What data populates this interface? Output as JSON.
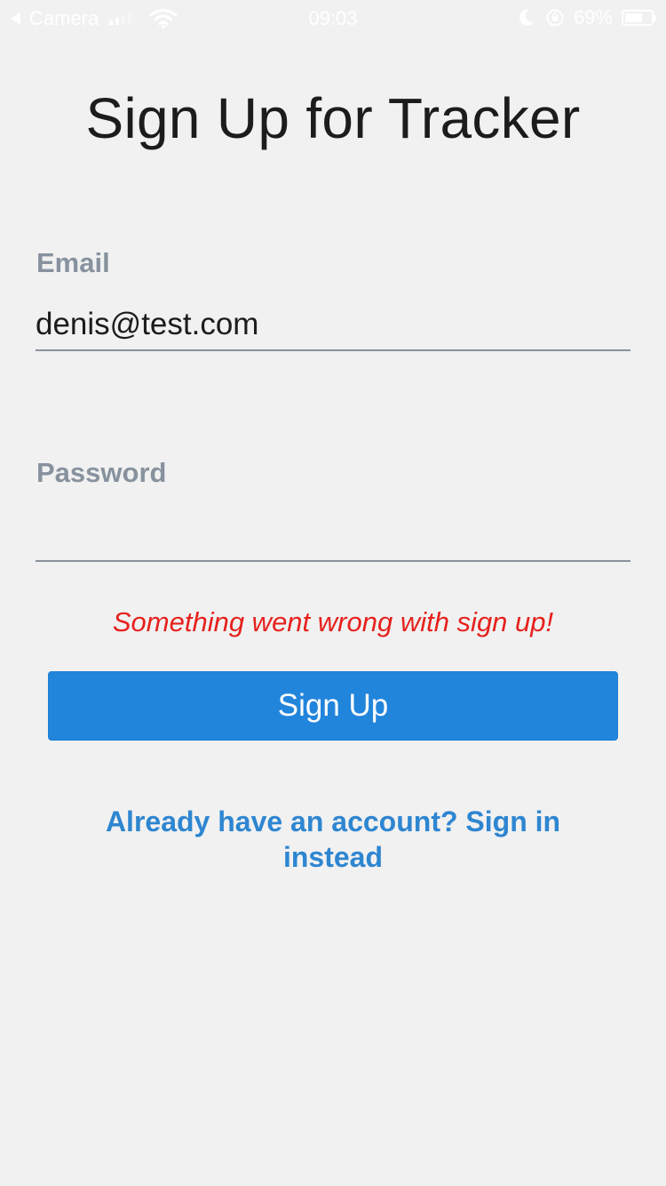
{
  "status_bar": {
    "back_app": "Camera",
    "time": "09:03",
    "battery_percent": "69%",
    "battery_level": 0.69,
    "icons": [
      "back-arrow-icon",
      "signal-icon",
      "wifi-icon",
      "moon-icon",
      "orientation-lock-icon",
      "battery-icon"
    ]
  },
  "page": {
    "title": "Sign Up for Tracker"
  },
  "form": {
    "email_label": "Email",
    "email_value": "denis@test.com",
    "password_label": "Password",
    "password_value": "",
    "error_message": "Something went wrong with sign up!",
    "submit_label": "Sign Up"
  },
  "footer": {
    "signin_link": "Already have an account? Sign in instead"
  },
  "colors": {
    "background": "#f1f1f1",
    "label": "#87929e",
    "error": "#e6211d",
    "button": "#2285dc",
    "link": "#2e86d1"
  }
}
